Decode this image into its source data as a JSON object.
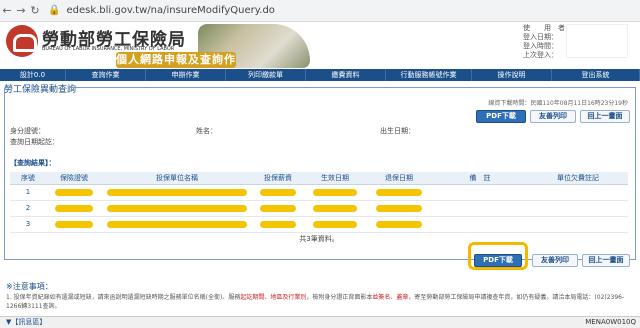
{
  "browser": {
    "url": "edesk.bli.gov.tw/na/insureModifyQuery.do"
  },
  "header": {
    "org_name": "勞動部勞工保險局",
    "org_name_en": "BUREAU OF LABOR INSURANCE, MINISTRY OF LABOR",
    "banner_title": "個人網路申報及查詢作業",
    "user_info_lines": [
      "使　　用　者：",
      "登入日期：",
      "登入時間：",
      "上次登入："
    ]
  },
  "menu": [
    "設計0.0",
    "查詢作業",
    "申辦作業",
    "列印繳款單",
    "繳費資料",
    "行動服務帳號作業",
    "操作說明",
    "登出系統"
  ],
  "section": {
    "title": "勞工保險異動查詢"
  },
  "print_time": "線資下載時間：民國110年08月11日16時23分19秒",
  "buttons": {
    "pdf": "PDF下載",
    "email": "友善列印",
    "back": "回上一畫面"
  },
  "fields": {
    "id_label": "身分證號：",
    "name_label": "姓名：",
    "birth_label": "出生日期：",
    "query_date_label": "查詢日期起訖："
  },
  "result": {
    "title": "【查詢結果】：",
    "columns": [
      "序號",
      "保險證號",
      "投保單位名稱",
      "投保薪資",
      "生效日期",
      "退保日期",
      "備　註",
      "單位欠費註記"
    ],
    "rows": [
      {
        "no": "1"
      },
      {
        "no": "2"
      },
      {
        "no": "3"
      }
    ],
    "summary": "共3筆資料。"
  },
  "notes": {
    "title": "※注意事項：",
    "text_a": "1. 投保年資紀錄如有遺漏或短缺，請來函說明遺漏短缺時期之服務單位名稱(全銜)、服務",
    "text_red1": "起訖期間、地區及行業別",
    "text_b": "，檢附身分證正背面影本",
    "text_red2": "並簽名、蓋章",
    "text_c": "，寄至勞動部勞工保險局申請複查年資，如仍有疑義，請洽本局電話：(02)2396-1266轉3111查詢。"
  },
  "status": {
    "left": "▼【訊息區】",
    "right": "MENA0W010Q"
  },
  "colors": {
    "brand": "#1a4f8a",
    "highlight": "#f5b800",
    "redaction": "#f5c400",
    "alert": "#d62020"
  }
}
